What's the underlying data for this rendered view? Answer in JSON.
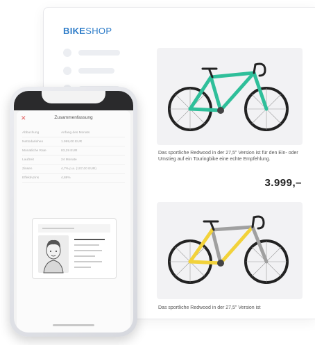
{
  "brand": {
    "bold": "BIKE",
    "light": "SHOP",
    "color": "#2d7cc8"
  },
  "products": [
    {
      "description": "Das sportliche Redwood in der 27,5\" Version ist für den Ein- oder Umstieg auf ein Touringbike eine echte Empfehlung.",
      "price": "3.999,–",
      "frame_color": "#2fbf9a"
    },
    {
      "description": "Das sportliche Redwood in der 27,5\" Version ist",
      "frame_color": "#f2d23a"
    }
  ],
  "financing_sheet": {
    "title": "Zusammenfassung",
    "rows": [
      {
        "label": "Abbuchung",
        "value": "Anfang des Monats"
      },
      {
        "label": "Nettodarlehen",
        "value": "1.999,00 EUR"
      },
      {
        "label": "Monatliche Rate",
        "value": "83,29 EUR"
      },
      {
        "label": "Laufzeit",
        "value": "24 Monate"
      },
      {
        "label": "Zinsen",
        "value": "4,7% p.a. (107,00 EUR)"
      },
      {
        "label": "Effektivzins",
        "value": "4,88%"
      }
    ]
  },
  "icons": {
    "close": "close-icon",
    "id_card": "id-card-icon"
  }
}
